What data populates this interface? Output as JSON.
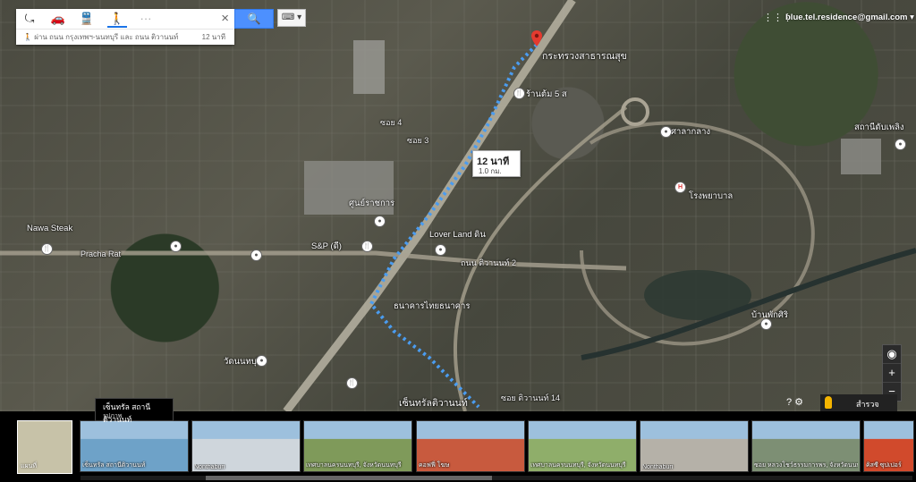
{
  "panel": {
    "route_text": "ผ่าน ถนน กรุงเทพฯ-นนทบุรี และ ถนน ติวานนท์",
    "route_time": "12 นาที",
    "close": "×",
    "search": "🔍",
    "keyboard": "⌨ ▾"
  },
  "account": {
    "email": "blue.tel.residence@gmail.com ▾",
    "apps": "⋮⋮⋮"
  },
  "route": {
    "destination": "กระทรวงสาธารณสุข",
    "start": "เซ็นทรัลติวานนท์",
    "walk_time": "12 นาที",
    "distance": "1.0 กม."
  },
  "map_labels": [
    "Nawa Steak",
    "Pracha Rat",
    "S&P (ดี)",
    "Lover Land ดิน",
    "ธนาคารไทยธนาคาร",
    "ร้านต้ม 5 ส",
    "ศาลากลาง",
    "โรงพยาบาล",
    "ซอย 4",
    "ซอย 3",
    "ถนน ติวานนท์ 2",
    "ซอย ติวานนท์ 14",
    "วัดนนทบุรี",
    "ศูนย์ราชการ",
    "บ้านพักศิริ",
    "สถานีดับเพลิง"
  ],
  "controls": {
    "zoom_in": "+",
    "zoom_out": "−",
    "compass": "◉",
    "streetview_label": "สำรวจ",
    "help": "? ⚙"
  },
  "tooltip": {
    "title": "เซ็นทรัล สถานีติวานนท์",
    "sub": "รูปภาพ"
  },
  "strip": {
    "map_caption": "แผนที่",
    "photos": [
      {
        "caption": "เซ็นทรัล สถานีติวานนท์",
        "color": "#6ea2c8"
      },
      {
        "caption": "Nonthaburi",
        "color": "#cfd6dc"
      },
      {
        "caption": "เทศบาลนครนนทบุรี, จังหวัดนนทบุรี",
        "color": "#7f9a5a"
      },
      {
        "caption": "คอฟฟี่ โฆษ",
        "color": "#c85a3e"
      },
      {
        "caption": "เทศบาลนครนนทบุรี, จังหวัดนนทบุรี",
        "color": "#8fae6a"
      },
      {
        "caption": "Nonthaburi",
        "color": "#b5b1a8"
      },
      {
        "caption": "ซอย หลวงโชว์ธรรมการพร, จังหวัดนนทบุรี",
        "color": "#7d8f74"
      },
      {
        "caption": "คิสซี ซุปเปอร์",
        "color": "#d14a2c"
      }
    ]
  }
}
